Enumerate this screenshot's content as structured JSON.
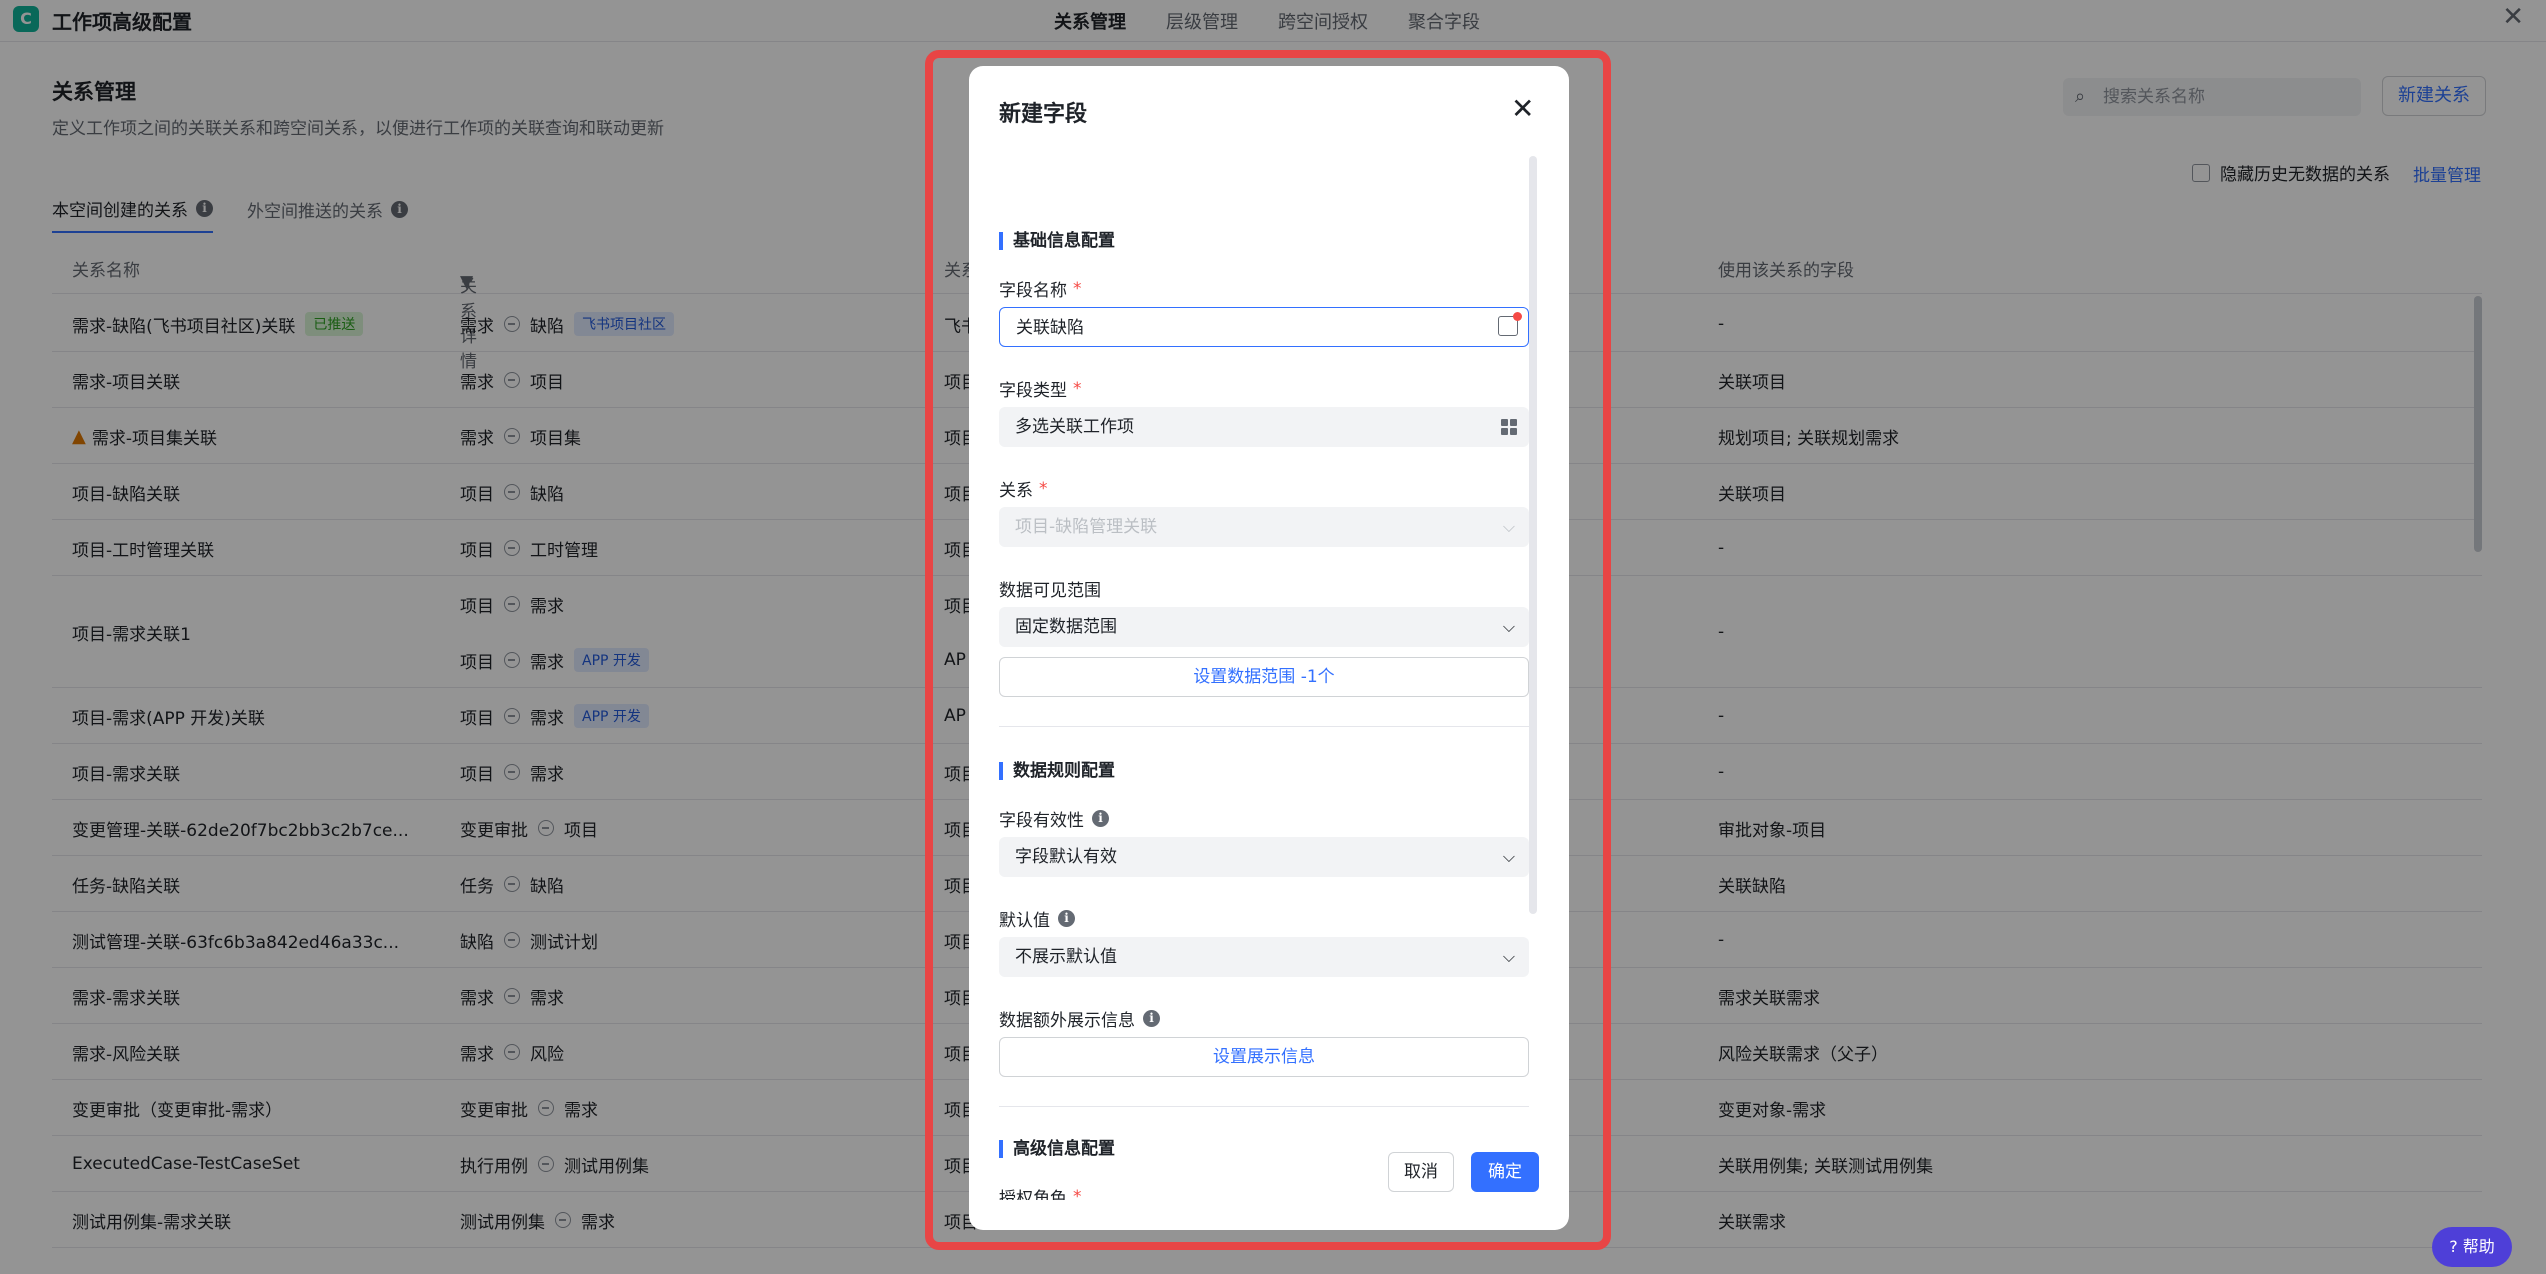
{
  "app": {
    "title": "工作项高级配置",
    "logo_glyph": "C",
    "close_glyph": "✕"
  },
  "top_tabs": [
    "关系管理",
    "层级管理",
    "跨空间授权",
    "聚合字段"
  ],
  "page": {
    "heading": "关系管理",
    "description": "定义工作项之间的关联关系和跨空间关系，以便进行工作项的关联查询和联动更新",
    "search_placeholder": "搜索关系名称",
    "new_button": "新建关系",
    "hide_history_label": "隐藏历史无数据的关系",
    "batch_manage": "批量管理"
  },
  "sub_tabs": [
    "本空间创建的关系",
    "外空间推送的关系"
  ],
  "table": {
    "headers": [
      "关系名称",
      "关系详情",
      "关系",
      "使用该关系的字段"
    ],
    "rows": [
      {
        "name": "需求-缺陷(飞书项目社区)关联",
        "name_tag": "已推送",
        "from": "需求",
        "to": "缺陷",
        "to_tag": "飞书项目社区",
        "col3": "飞书",
        "fields": "-"
      },
      {
        "name": "需求-项目关联",
        "from": "需求",
        "to": "项目",
        "col3": "项目",
        "fields": "关联项目"
      },
      {
        "name": "需求-项目集关联",
        "warn": "▲",
        "from": "需求",
        "to": "项目集",
        "col3": "项目",
        "fields": "规划项目; 关联规划需求"
      },
      {
        "name": "项目-缺陷关联",
        "from": "项目",
        "to": "缺陷",
        "col3": "项目",
        "fields": "关联项目"
      },
      {
        "name": "项目-工时管理关联",
        "from": "项目",
        "to": "工时管理",
        "col3": "项目",
        "fields": "-"
      },
      {
        "name": "项目-需求关联1",
        "from": "项目",
        "to": "需求",
        "col3": "项目",
        "from2": "项目",
        "to2": "需求",
        "to2_tag": "APP 开发",
        "col3b": "AP",
        "fields": "-"
      },
      {
        "name": "项目-需求(APP 开发)关联",
        "from": "项目",
        "to": "需求",
        "to_tag": "APP 开发",
        "col3": "AP",
        "fields": "-"
      },
      {
        "name": "项目-需求关联",
        "from": "项目",
        "to": "需求",
        "col3": "项目",
        "fields": "-"
      },
      {
        "name": "变更管理-关联-62de20f7bc2bb3c2b7ce...",
        "from": "变更审批",
        "to": "项目",
        "col3": "项目",
        "fields": "审批对象-项目"
      },
      {
        "name": "任务-缺陷关联",
        "from": "任务",
        "to": "缺陷",
        "col3": "项目",
        "fields": "关联缺陷"
      },
      {
        "name": "测试管理-关联-63fc6b3a842ed46a33c...",
        "from": "缺陷",
        "to": "测试计划",
        "col3": "项目",
        "fields": "-"
      },
      {
        "name": "需求-需求关联",
        "from": "需求",
        "to": "需求",
        "col3": "项目",
        "fields": "需求关联需求"
      },
      {
        "name": "需求-风险关联",
        "from": "需求",
        "to": "风险",
        "col3": "项目",
        "fields": "风险关联需求（父子）"
      },
      {
        "name": "变更审批（变更审批-需求）",
        "from": "变更审批",
        "to": "需求",
        "col3": "项目",
        "fields": "变更对象-需求"
      },
      {
        "name": "ExecutedCase-TestCaseSet",
        "from": "执行用例",
        "to": "测试用例集",
        "col3": "项目",
        "fields": "关联用例集; 关联测试用例集"
      },
      {
        "name": "测试用例集-需求关联",
        "from": "测试用例集",
        "to": "需求",
        "col3": "项目",
        "fields": "关联需求"
      }
    ]
  },
  "help_button": "帮助",
  "modal": {
    "title": "新建字段",
    "close_glyph": "✕",
    "section_basic": "基础信息配置",
    "field_name_label": "字段名称",
    "field_name_value": "关联缺陷",
    "field_type_label": "字段类型",
    "field_type_value": "多选关联工作项",
    "relation_label": "关系",
    "relation_value": "项目-缺陷管理关联",
    "visible_range_label": "数据可见范围",
    "visible_range_value": "固定数据范围",
    "set_range_button": "设置数据范围 -1个",
    "section_rules": "数据规则配置",
    "validity_label": "字段有效性",
    "validity_value": "字段默认有效",
    "default_label": "默认值",
    "default_value": "不展示默认值",
    "extra_info_label": "数据额外展示信息",
    "set_display_button": "设置展示信息",
    "section_advanced": "高级信息配置",
    "auth_role_label": "授权角色",
    "required_mark": "*",
    "chevron": "⌵",
    "cancel": "取消",
    "confirm": "确定"
  },
  "colors": {
    "accent": "#3370ff",
    "highlight_frame": "#e84545",
    "required": "#f54a45"
  }
}
